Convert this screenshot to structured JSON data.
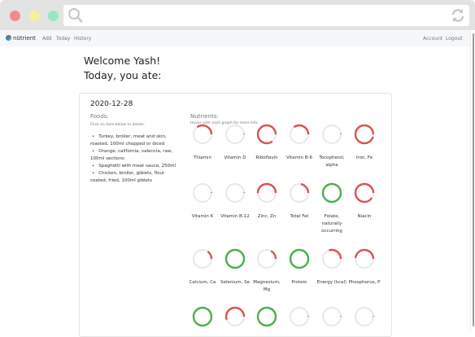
{
  "browser": {
    "search_icon": "search-icon",
    "reload_icon": "reload-icon"
  },
  "nav": {
    "brand": "nūtrient",
    "links": [
      "Add",
      "Today",
      "History"
    ],
    "right": [
      "Account",
      "Logout"
    ]
  },
  "welcome": "Welcome Yash!",
  "subtitle": "Today, you ate:",
  "card": {
    "date": "2020-12-28",
    "foods_title": "Foods:",
    "foods_hint": "Click on item below to delete.",
    "foods": [
      "Turkey, broiler, meat and skin, roasted, 100ml chopped or diced",
      "Orange, california, valencia, raw, 100ml sections",
      "Spaghetti with meat sauce, 250ml",
      "Chicken, broiler, giblets, flour coated, fried, 100ml giblets"
    ],
    "nutrients_title": "Nutrients:",
    "nutrients_hint": "Hover over each graph for more info.",
    "nutrients": [
      {
        "name": "Thiamin",
        "pct": 35,
        "status": "low"
      },
      {
        "name": "Vitamin D",
        "pct": 1,
        "status": "low"
      },
      {
        "name": "Riboflavin",
        "pct": 85,
        "status": "low"
      },
      {
        "name": "Vitamin B-6",
        "pct": 35,
        "status": "low"
      },
      {
        "name": "Tocopherol, alpha",
        "pct": 1,
        "status": "low"
      },
      {
        "name": "Iron, Fe",
        "pct": 95,
        "status": "low"
      },
      {
        "name": "Vitamin K",
        "pct": 0.5,
        "status": "low"
      },
      {
        "name": "Vitamin B-12",
        "pct": 0.5,
        "status": "low"
      },
      {
        "name": "Zinc, Zn",
        "pct": 50,
        "status": "low"
      },
      {
        "name": "Total Fat",
        "pct": 22,
        "status": "low"
      },
      {
        "name": "Folate, naturally occurring",
        "pct": 100,
        "status": "met"
      },
      {
        "name": "Niacin",
        "pct": 90,
        "status": "low"
      },
      {
        "name": "Calcium, Ca",
        "pct": 15,
        "status": "low"
      },
      {
        "name": "Selenium, Se",
        "pct": 100,
        "status": "met"
      },
      {
        "name": "Magnesium, Mg",
        "pct": 17,
        "status": "low"
      },
      {
        "name": "Protein",
        "pct": 100,
        "status": "met"
      },
      {
        "name": "Energy (kcal)",
        "pct": 30,
        "status": "low"
      },
      {
        "name": "Phosphorus, P",
        "pct": 48,
        "status": "low"
      },
      {
        "name": "",
        "pct": 100,
        "status": "met"
      },
      {
        "name": "",
        "pct": 55,
        "status": "low"
      },
      {
        "name": "",
        "pct": 100,
        "status": "met"
      },
      {
        "name": "",
        "pct": 1,
        "status": "low"
      },
      {
        "name": "",
        "pct": 0,
        "status": "low"
      },
      {
        "name": "",
        "pct": 0.5,
        "status": "low"
      }
    ]
  },
  "colors": {
    "low": "#d9534f",
    "met": "#4cae4c",
    "track": "#e8e8e8"
  }
}
